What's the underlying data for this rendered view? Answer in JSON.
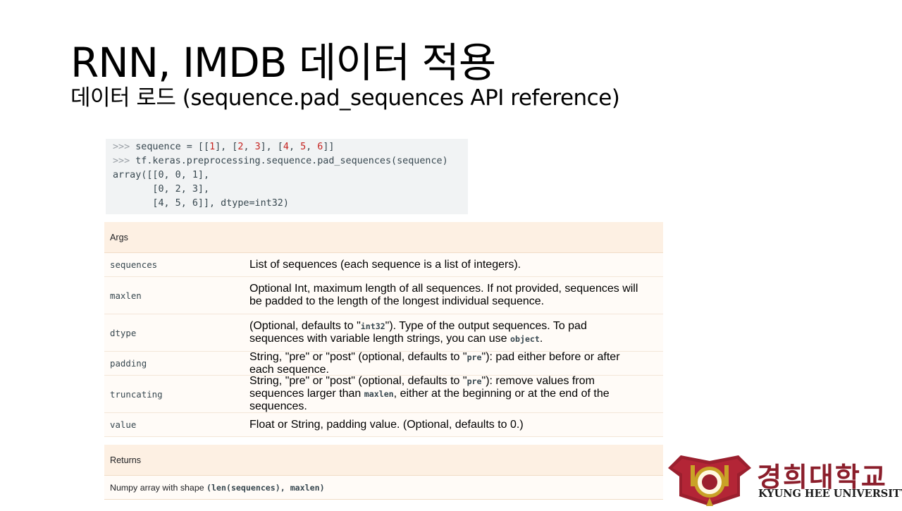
{
  "slide": {
    "title": "RNN, IMDB 데이터 적용",
    "subtitle": "데이터 로드 (sequence.pad_sequences API reference)"
  },
  "code": {
    "l1_prompt": ">>> ",
    "l1_a": "sequence = [[",
    "l1_n1": "1",
    "l1_b": "], [",
    "l1_n2": "2",
    "l1_c": ", ",
    "l1_n3": "3",
    "l1_d": "], [",
    "l1_n4": "4",
    "l1_e": ", ",
    "l1_n5": "5",
    "l1_f": ", ",
    "l1_n6": "6",
    "l1_g": "]]",
    "l2_prompt": ">>> ",
    "l2_text": "tf.keras.preprocessing.sequence.pad_sequences(sequence)",
    "l3": "array([[0, 0, 1],",
    "l4": "       [0, 2, 3],",
    "l5": "       [4, 5, 6]], dtype=int32)"
  },
  "args": {
    "header": "Args",
    "rows": [
      {
        "name": "sequences",
        "desc": "List of sequences (each sequence is a list of integers)."
      },
      {
        "name": "maxlen",
        "desc": "Optional Int, maximum length of all sequences. If not provided, sequences will be padded to the length of the longest individual sequence."
      },
      {
        "name": "dtype",
        "desc_a": "(Optional, defaults to \"",
        "code1": "int32",
        "desc_b": "\"). Type of the output sequences. To pad sequences with variable length strings, you can use ",
        "code2": "object",
        "desc_c": "."
      },
      {
        "name": "padding",
        "desc_a": "String, \"pre\" or \"post\" (optional, defaults to \"",
        "code1": "pre",
        "desc_b": "\"): pad either before or after each sequence."
      },
      {
        "name": "truncating",
        "desc_a": "String, \"pre\" or \"post\" (optional, defaults to \"",
        "code1": "pre",
        "desc_b": "\"): remove values from sequences larger than ",
        "code2": "maxlen",
        "desc_c": ", either at the beginning or at the end of the sequences."
      },
      {
        "name": "value",
        "desc": "Float or String, padding value. (Optional, defaults to 0.)"
      }
    ]
  },
  "returns": {
    "header": "Returns",
    "text_a": "Numpy array with shape ",
    "code": "(len(sequences), maxlen)"
  },
  "logo": {
    "korean": "경희대학교",
    "english": "KYUNG HEE UNIVERSITY",
    "colors": {
      "primary": "#8b1e2b",
      "gold": "#c9a227"
    }
  }
}
